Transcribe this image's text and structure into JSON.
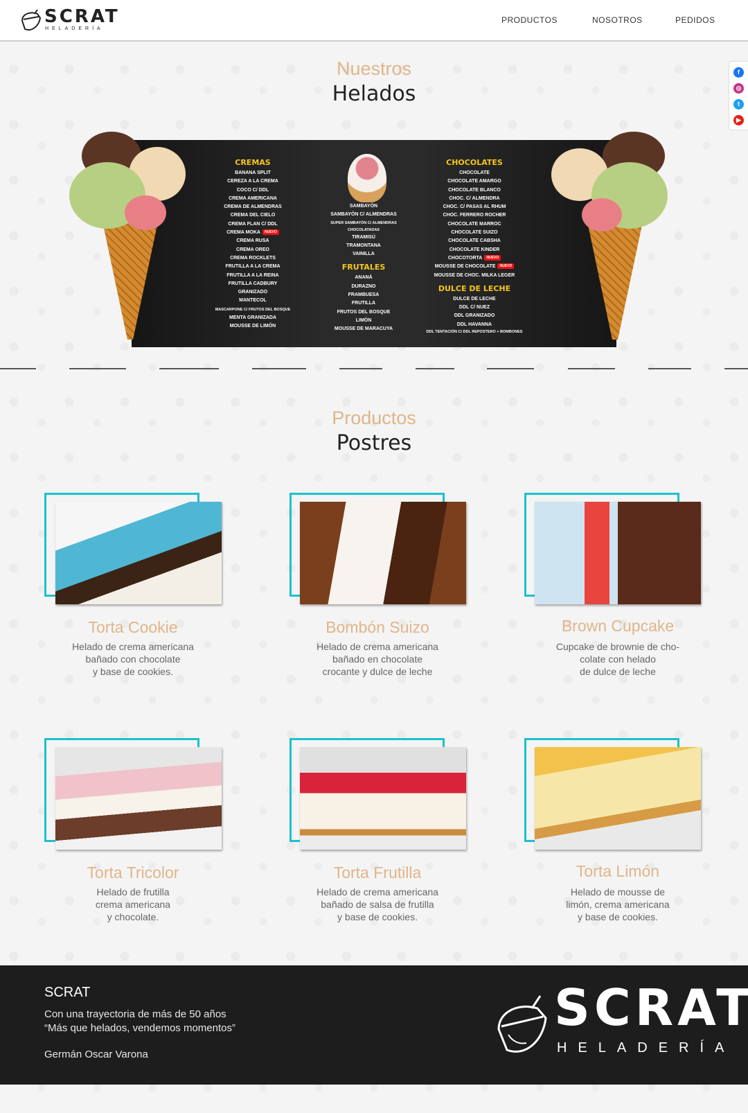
{
  "header": {
    "brand": "SCRAT",
    "brand_sub": "HELADERÍA",
    "nav": [
      "PRODUCTOS",
      "NOSOTROS",
      "PEDIDOS"
    ]
  },
  "social": [
    "facebook-icon",
    "instagram-icon",
    "twitter-icon",
    "youtube-icon"
  ],
  "helados": {
    "kicker": "Nuestros",
    "title": "Helados",
    "menu": {
      "cremas": {
        "heading": "CREMAS",
        "items": [
          "BANANA SPLIT",
          "CEREZA A LA CREMA",
          "COCO C/ DDL",
          "CREMA AMERICANA",
          "CREMA DE ALMENDRAS",
          "CREMA DEL CIELO",
          "CREMA FLAN C/ DDL",
          "CREMA MOKA",
          "CREMA RUSA",
          "CREMA OREO",
          "CREMA ROCKLETS",
          "FRUTILLA A LA CREMA",
          "FRUTILLA A LA REINA",
          "FRUTILLA CADBURY",
          "GRANIZADO",
          "MANTECOL",
          "MASCARPONE C/ FRUTOS DEL BOSQUE",
          "MENTA GRANIZADA",
          "MOUSSE DE LIMÓN"
        ]
      },
      "centro": {
        "items": [
          "SAMBAYÓN",
          "SAMBAYÓN C/ ALMENDRAS",
          "SUPER SAMBAYÓN C/ ALMENDRAS CHOCOLATADAS",
          "TIRAMISÚ",
          "TRAMONTANA",
          "VAINILLA"
        ],
        "frutales_heading": "FRUTALES",
        "frutales": [
          "ANANÁ",
          "DURAZNO",
          "FRAMBUESA",
          "FRUTILLA",
          "FRUTOS DEL BOSQUE",
          "LIMÓN",
          "MOUSSE DE MARACUYA"
        ]
      },
      "chocolates": {
        "heading": "CHOCOLATES",
        "items": [
          "CHOCOLATE",
          "CHOCOLATE AMARGO",
          "CHOCOLATE BLANCO",
          "CHOC. C/ ALMENDRA",
          "CHOC. C/ PASAS AL RHUM",
          "CHOC. FERRERO ROCHER",
          "CHOCOLATE MARROC",
          "CHOCOLATE SUIZO",
          "CHOCOLATE CABSHA",
          "CHOCOLATE KINDER",
          "CHOCOTORTA",
          "MOUSSE DE CHOCOLATE",
          "MOUSSE DE CHOC. MILKA LEGER"
        ]
      },
      "ddl": {
        "heading": "DULCE DE LECHE",
        "items": [
          "DULCE DE LECHE",
          "DDL C/ NUEZ",
          "DDL GRANIZADO",
          "DDL HAVANNA",
          "DDL TENTACIÓN C/ DDL REPOSTERO + BOMBONES"
        ]
      },
      "nuevo_label": "NUEVO"
    }
  },
  "postres": {
    "kicker": "Productos",
    "title": "Postres",
    "items": [
      {
        "name": "Torta Cookie",
        "desc": "Helado de crema americana\nbañado con chocolate\ny base de cookies.",
        "colors": [
          "#4fb7d4",
          "#3b2415",
          "#f4efe6"
        ]
      },
      {
        "name": "Bombón Suizo",
        "desc": "Helado de crema americana\nbañado en chocolate\ncrocante y dulce de leche",
        "colors": [
          "#7a3f1c",
          "#f7f3ee",
          "#4a2411"
        ]
      },
      {
        "name": "Brown Cupcake",
        "desc": "Cupcake de brownie de cho-\ncolate con helado\nde dulce de leche",
        "colors": [
          "#cfe4f1",
          "#5a2a1a",
          "#e8453f"
        ]
      },
      {
        "name": "Torta Tricolor",
        "desc": "Helado de frutilla\ncrema americana\ny chocolate.",
        "colors": [
          "#f0c2c9",
          "#f7f2ea",
          "#6b3d2a"
        ]
      },
      {
        "name": "Torta Frutilla",
        "desc": "Helado de crema americana\nbañado de salsa de frutilla\ny base de cookies.",
        "colors": [
          "#e0e0e0",
          "#d8233a",
          "#f8f1e6"
        ]
      },
      {
        "name": "Torta Limón",
        "desc": "Helado de mousse de\nlimón, crema americana\ny base de cookies.",
        "colors": [
          "#f2c24a",
          "#f6e7a8",
          "#e9e9e9"
        ]
      }
    ]
  },
  "footer": {
    "title": "SCRAT",
    "line1": "Con una trayectoria de más de 50 años",
    "line2": "“Más que helados, vendemos momentos”",
    "author": "Germán Oscar Varona",
    "brand": "SCRAT",
    "brand_sub": "HELADERÍA"
  }
}
